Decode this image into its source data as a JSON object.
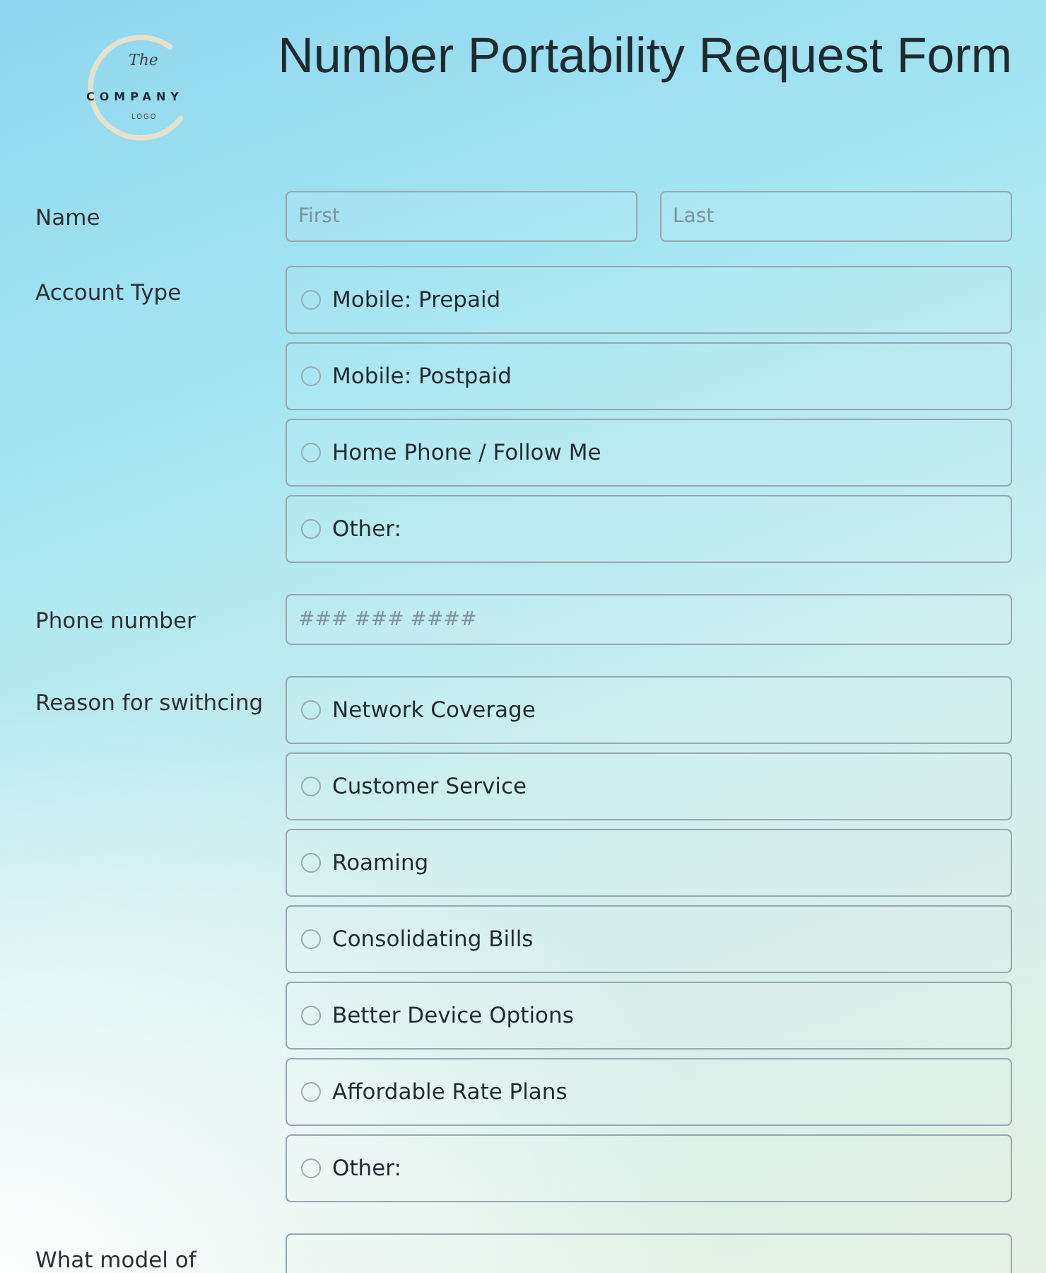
{
  "logo": {
    "script": "The",
    "name": "COMPANY",
    "tag": "LOGO"
  },
  "title": "Number Portability Request Form",
  "fields": [
    {
      "kind": "name",
      "label": "Name",
      "inputs": [
        {
          "placeholder": "First"
        },
        {
          "placeholder": "Last"
        }
      ]
    },
    {
      "kind": "radio",
      "label": "Account Type",
      "options": [
        {
          "label": "Mobile: Prepaid",
          "selected": false
        },
        {
          "label": "Mobile: Postpaid",
          "selected": false
        },
        {
          "label": "Home Phone / Follow Me",
          "selected": false
        },
        {
          "label": "Other:",
          "selected": false
        }
      ]
    },
    {
      "kind": "text",
      "label": "Phone number",
      "placeholder": "### ### ####"
    },
    {
      "kind": "radio",
      "label": "Reason for swithcing",
      "options": [
        {
          "label": "Network Coverage",
          "selected": false
        },
        {
          "label": "Customer Service",
          "selected": false
        },
        {
          "label": "Roaming",
          "selected": false
        },
        {
          "label": "Consolidating Bills",
          "selected": false
        },
        {
          "label": "Better Device Options",
          "selected": false
        },
        {
          "label": "Affordable Rate Plans",
          "selected": false
        },
        {
          "label": "Other:",
          "selected": false
        }
      ]
    },
    {
      "kind": "text",
      "label": "What model of"
    }
  ]
}
